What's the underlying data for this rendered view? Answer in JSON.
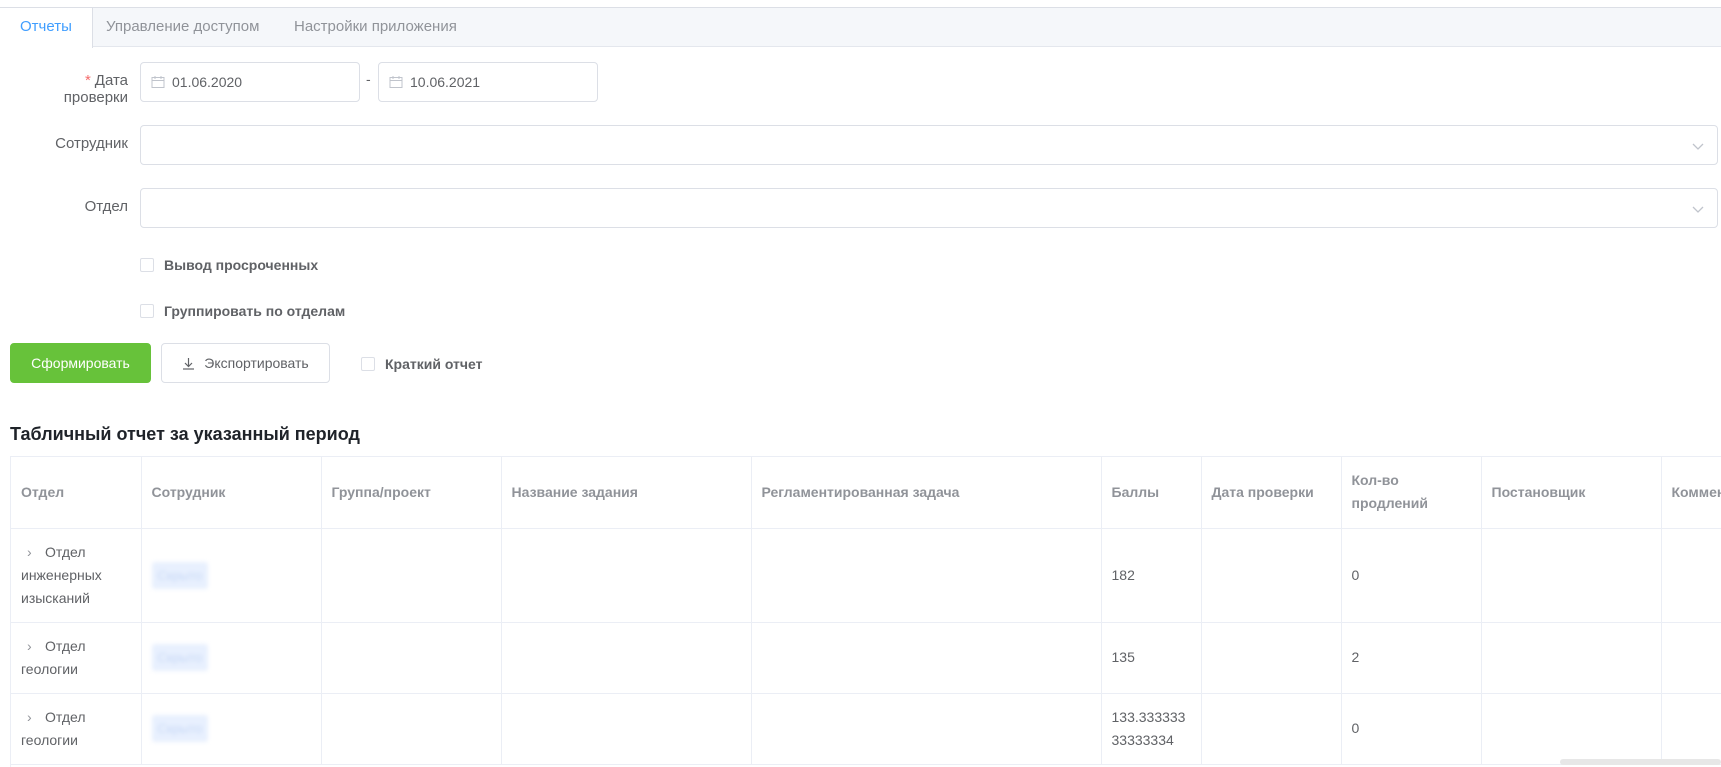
{
  "tabs": [
    {
      "label": "Отчеты",
      "active": true
    },
    {
      "label": "Управление доступом",
      "active": false
    },
    {
      "label": "Настройки приложения",
      "active": false
    }
  ],
  "form": {
    "date_label": "Дата проверки",
    "date_required_mark": "*",
    "date_from": "01.06.2020",
    "date_separator": "-",
    "date_to": "10.06.2021",
    "employee_label": "Сотрудник",
    "employee_value": "",
    "department_label": "Отдел",
    "department_value": "",
    "checkbox_overdue": "Вывод просроченных",
    "checkbox_group": "Группировать по отделам",
    "checkbox_short": "Краткий отчет"
  },
  "buttons": {
    "generate": "Сформировать",
    "export": "Экспортировать"
  },
  "report": {
    "title": "Табличный отчет за указанный период",
    "columns": [
      "Отдел",
      "Сотрудник",
      "Группа/проект",
      "Название задания",
      "Регламентированная задача",
      "Баллы",
      "Дата проверки",
      "Кол-во продлений",
      "Постановщик",
      "Комментарий"
    ],
    "rows": [
      {
        "department": "Отдел инженерных изысканий",
        "employee": "Скрыто",
        "group": "",
        "task": "",
        "regulated": "",
        "score": "182",
        "check_date": "",
        "extensions": "0",
        "assigner": "",
        "comment": ""
      },
      {
        "department": "Отдел геологии",
        "employee": "Скрыто",
        "group": "",
        "task": "",
        "regulated": "",
        "score": "135",
        "check_date": "",
        "extensions": "2",
        "assigner": "",
        "comment": ""
      },
      {
        "department": "Отдел геологии",
        "employee": "Скрыто",
        "group": "",
        "task": "",
        "regulated": "",
        "score": "133.333333 33333334",
        "check_date": "",
        "extensions": "0",
        "assigner": "",
        "comment": ""
      }
    ]
  },
  "colors": {
    "accent": "#409eff",
    "primary_button": "#67c23a",
    "required": "#f56c6c"
  }
}
